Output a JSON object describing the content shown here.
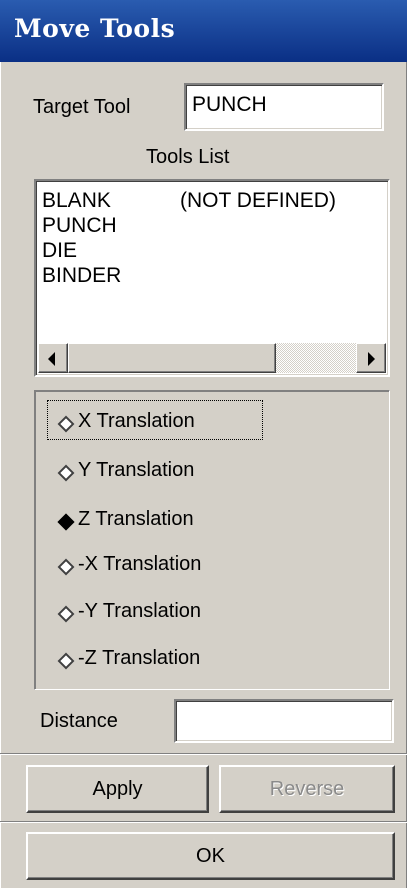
{
  "window": {
    "title": "Move Tools"
  },
  "target_tool": {
    "label": "Target Tool",
    "value": "PUNCH"
  },
  "tools_list": {
    "header": "Tools  List",
    "items": [
      {
        "name": "BLANK",
        "status": "(NOT DEFINED)"
      },
      {
        "name": "PUNCH",
        "status": ""
      },
      {
        "name": "DIE",
        "status": ""
      },
      {
        "name": "BINDER",
        "status": ""
      }
    ]
  },
  "translation_options": {
    "items": [
      {
        "label": "X Translation",
        "selected": false
      },
      {
        "label": "Y Translation",
        "selected": false
      },
      {
        "label": "Z Translation",
        "selected": true
      },
      {
        "label": "-X Translation",
        "selected": false
      },
      {
        "label": "-Y Translation",
        "selected": false
      },
      {
        "label": "-Z Translation",
        "selected": false
      }
    ]
  },
  "distance": {
    "label": "Distance",
    "value": ""
  },
  "buttons": {
    "apply": "Apply",
    "reverse": "Reverse",
    "ok": "OK"
  },
  "colors": {
    "title_bar": "#0a2f85",
    "face": "#d4d0c8",
    "field": "#ffffff"
  }
}
